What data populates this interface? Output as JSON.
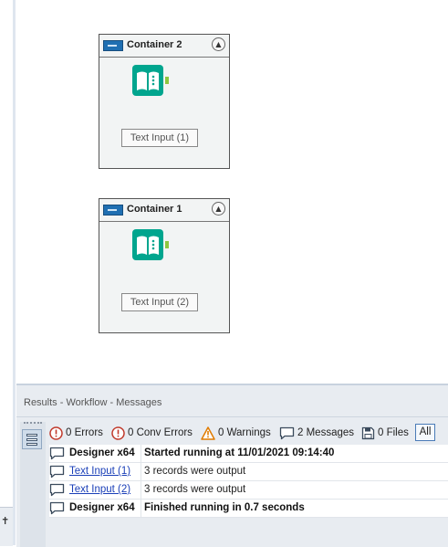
{
  "canvas": {
    "containers": [
      {
        "title": "Container 2",
        "tool_label": "Text Input (1)"
      },
      {
        "title": "Container 1",
        "tool_label": "Text Input (2)"
      }
    ]
  },
  "results": {
    "title": "Results - Workflow - Messages",
    "toolbar": {
      "errors": "0 Errors",
      "conv_errors": "0 Conv Errors",
      "warnings": "0 Warnings",
      "messages": "2 Messages",
      "files": "0 Files",
      "all": "All"
    },
    "rows": [
      {
        "source": "Designer x64",
        "text": "Started running at 11/01/2021 09:14:40"
      },
      {
        "source": "Text Input (1)",
        "text": "3 records were output"
      },
      {
        "source": "Text Input (2)",
        "text": "3 records were output"
      },
      {
        "source": "Designer x64",
        "text": "Finished running in 0.7 seconds"
      }
    ]
  },
  "colors": {
    "tool_teal": "#00a58e",
    "error_red": "#c0392b",
    "warning_orange": "#e07b00",
    "link_blue": "#1a3fb8",
    "container_blue": "#1f6fb2"
  },
  "icons": {
    "container": "container-icon",
    "collapse": "collapse-chevron-icon",
    "tool": "text-input-book-icon",
    "message": "speech-bubble-icon",
    "error": "exclamation-circle-icon",
    "warning": "warning-triangle-icon",
    "file": "floppy-disk-icon"
  }
}
